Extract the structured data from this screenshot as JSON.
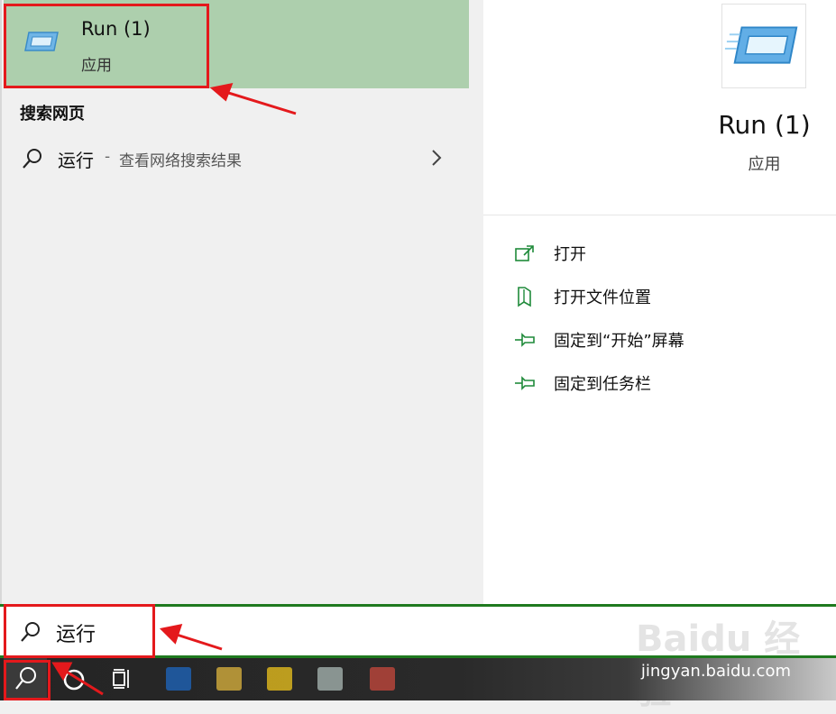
{
  "best_match": {
    "title": "Run (1)",
    "subtitle": "应用"
  },
  "web_section": {
    "header": "搜索网页",
    "query": "运行",
    "separator": "-",
    "hint": "查看网络搜索结果"
  },
  "preview": {
    "title": "Run (1)",
    "subtitle": "应用",
    "actions": [
      {
        "label": "打开",
        "icon": "open-icon"
      },
      {
        "label": "打开文件位置",
        "icon": "file-location-icon"
      },
      {
        "label": "固定到“开始”屏幕",
        "icon": "pin-icon"
      },
      {
        "label": "固定到任务栏",
        "icon": "pin-icon"
      }
    ]
  },
  "search": {
    "value": "运行"
  },
  "taskbar": {
    "watermark": "jingyan.baidu.com",
    "logo": "Baidu 经验"
  },
  "colors": {
    "accent": "#1f7a1f",
    "selection": "#adcfad",
    "annotation": "#e4191c"
  }
}
